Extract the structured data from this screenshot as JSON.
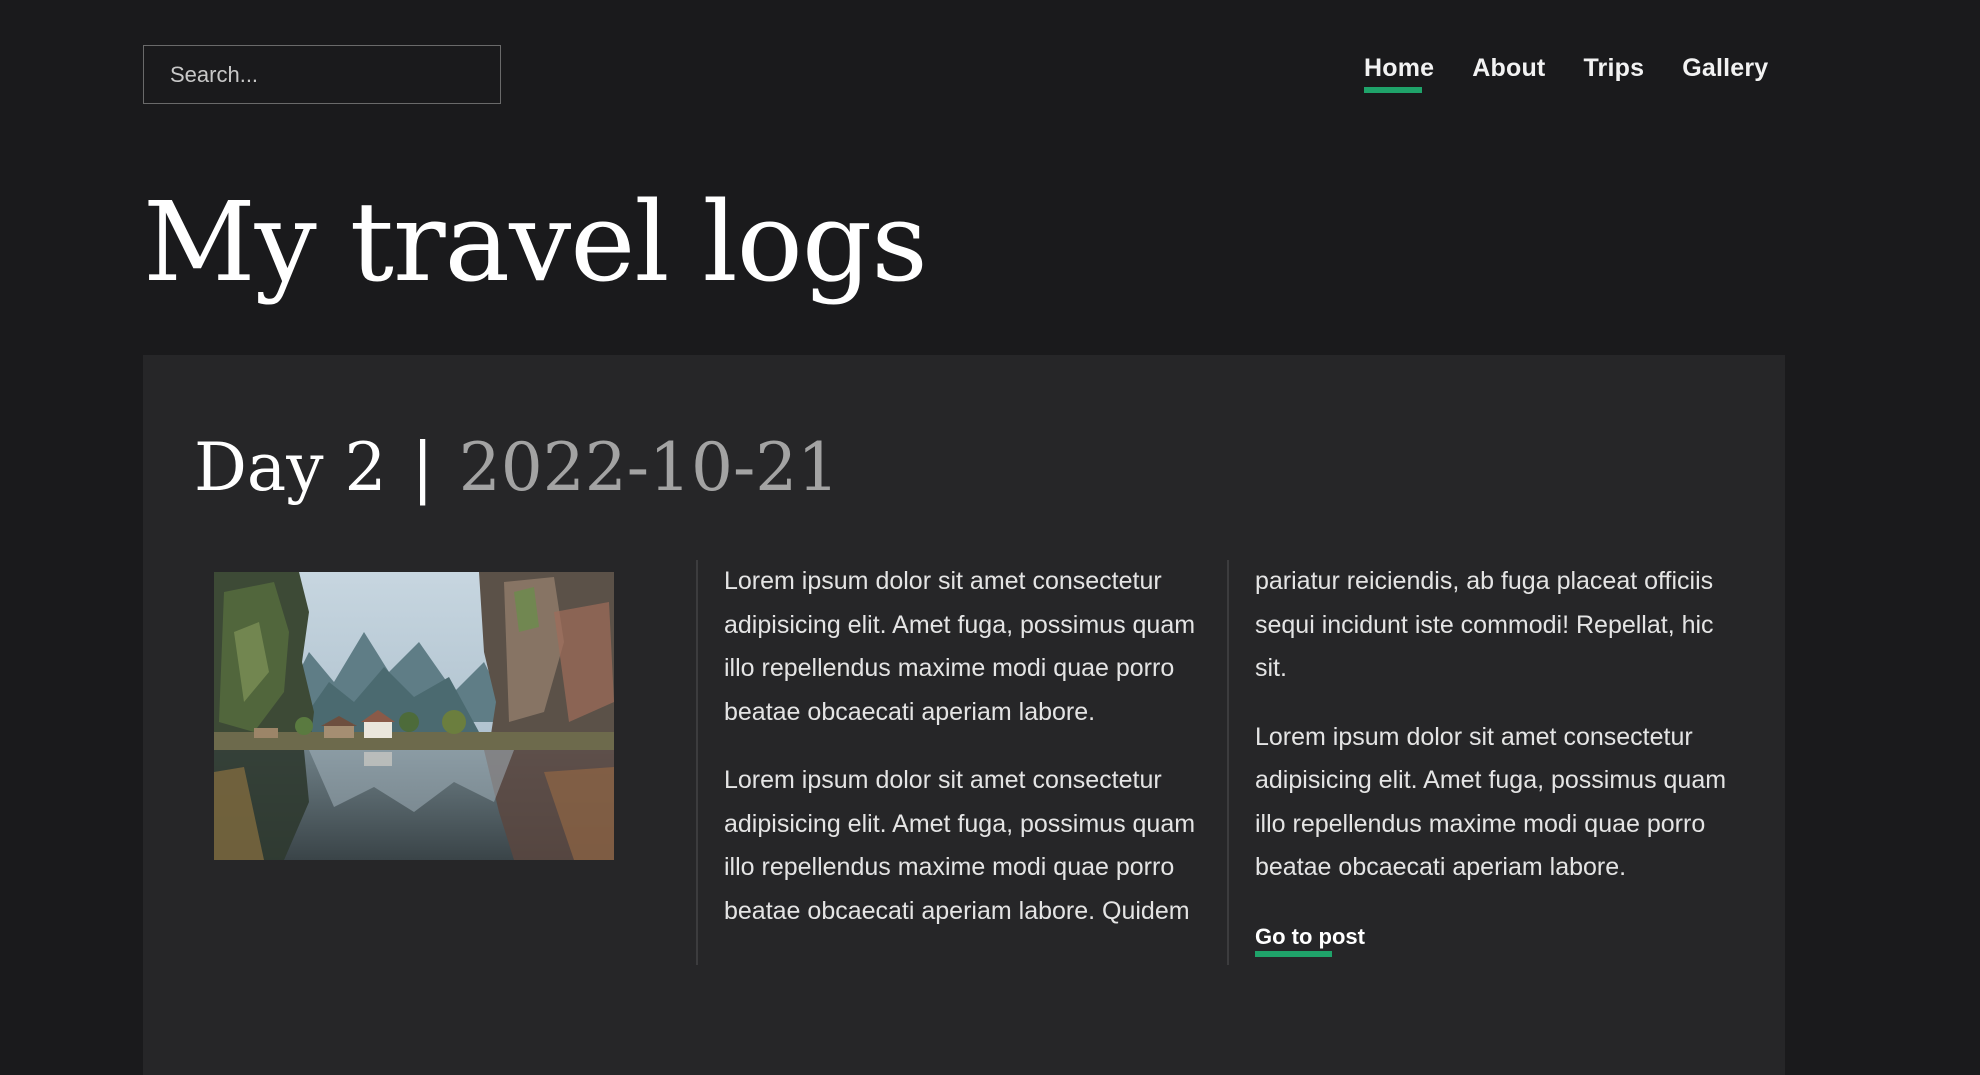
{
  "header": {
    "search_placeholder": "Search...",
    "nav": [
      {
        "label": "Home",
        "active": true
      },
      {
        "label": "About",
        "active": false
      },
      {
        "label": "Trips",
        "active": false
      },
      {
        "label": "Gallery",
        "active": false
      }
    ]
  },
  "hero": {
    "title": "My travel logs"
  },
  "post": {
    "day": "Day 2",
    "separator": "|",
    "date": "2022-10-21",
    "image_icon": "landscape-photo",
    "col1": [
      "Lorem ipsum dolor sit amet consectetur adipisicing elit. Amet fuga, possimus quam illo repellendus maxime modi quae porro beatae obcaecati aperiam labore.",
      "Lorem ipsum dolor sit amet consectetur adipisicing elit. Amet fuga, possimus quam illo repellendus maxime modi quae porro beatae obcaecati aperiam labore. Quidem"
    ],
    "col2": [
      "pariatur reiciendis, ab fuga placeat officiis sequi incidunt iste commodi! Repellat, hic sit.",
      "Lorem ipsum dolor sit amet consectetur adipisicing elit. Amet fuga, possimus quam illo repellendus maxime modi quae porro beatae obcaecati aperiam labore."
    ],
    "cta_label": "Go to post"
  },
  "colors": {
    "background": "#1a1a1c",
    "card": "#262628",
    "accent": "#1fa36a",
    "date_text": "#a3a3a3"
  }
}
